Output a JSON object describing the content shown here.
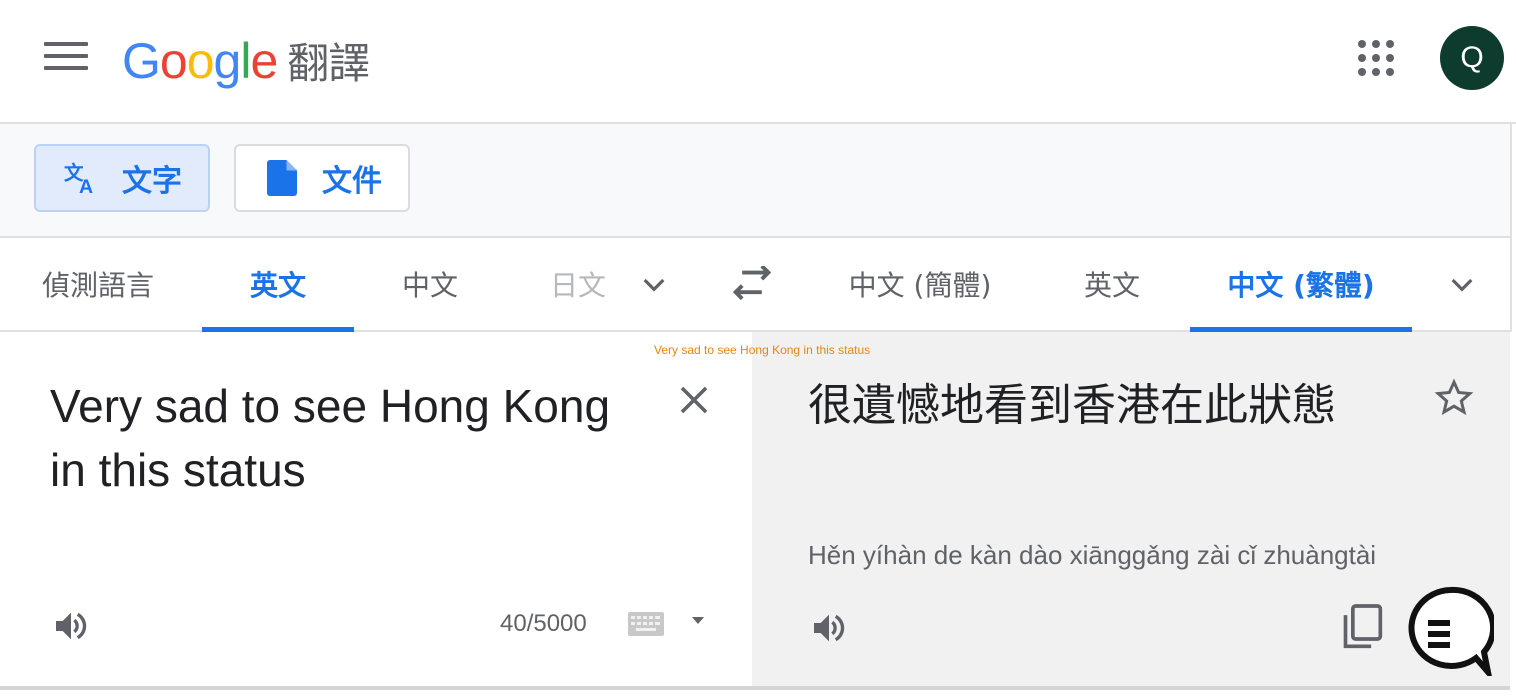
{
  "header": {
    "logo": {
      "letters": [
        "G",
        "o",
        "o",
        "g",
        "l",
        "e"
      ],
      "colors": [
        "#4285F4",
        "#EA4335",
        "#FBBC05",
        "#4285F4",
        "#34A853",
        "#EA4335"
      ],
      "product": "翻譯"
    },
    "apps_icon": "apps-grid-icon",
    "avatar_letter": "Q",
    "avatar_color": "#0d3b2e"
  },
  "modes": {
    "text_label": "文字",
    "document_label": "文件"
  },
  "source_languages": {
    "items": [
      "偵測語言",
      "英文",
      "中文",
      "日文"
    ],
    "active_index": 1
  },
  "target_languages": {
    "items": [
      "中文 (簡體)",
      "英文",
      "中文 (繁體)"
    ],
    "active_index": 2
  },
  "source": {
    "text": "Very sad to see Hong Kong in this status",
    "char_count": "40/5000"
  },
  "target": {
    "text": "很遺憾地看到香港在此狀態",
    "romanization": "Hěn yíhàn de kàn dào xiānggǎng zài cǐ zhuàngtài"
  },
  "tooltip": "Very sad to see Hong Kong in this status",
  "accent_color": "#1a73e8"
}
